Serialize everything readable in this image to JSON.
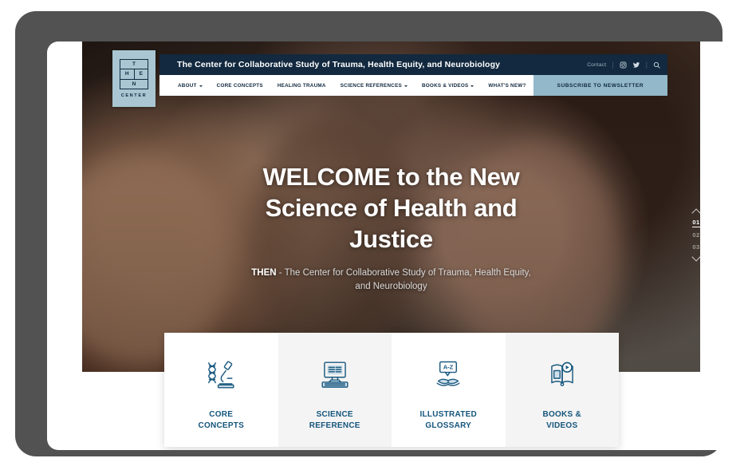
{
  "device": {
    "bezel_color": "#525252",
    "screen_bg": "#ffffff"
  },
  "brand": {
    "accent_navy": "#12293f",
    "accent_steel": "#92b8c9",
    "card_text": "#14557c",
    "logo": {
      "row1": [
        "T"
      ],
      "row2": [
        "H",
        "E"
      ],
      "row3": [
        "N"
      ],
      "word": "CENTER"
    }
  },
  "topbar": {
    "site_title": "The Center for Collaborative Study of Trauma, Health Equity, and Neurobiology",
    "contact_label": "Contact",
    "icons": [
      "instagram-icon",
      "twitter-icon",
      "search-icon"
    ]
  },
  "menubar": {
    "items": [
      {
        "label": "ABOUT",
        "has_caret": true
      },
      {
        "label": "CORE CONCEPTS",
        "has_caret": false
      },
      {
        "label": "HEALING TRAUMA",
        "has_caret": false
      },
      {
        "label": "SCIENCE REFERENCES",
        "has_caret": true
      },
      {
        "label": "BOOKS & VIDEOS",
        "has_caret": true
      },
      {
        "label": "WHAT'S NEW?",
        "has_caret": false
      }
    ],
    "subscribe_label": "SUBSCRIBE TO NEWSLETTER"
  },
  "hero": {
    "headline": "WELCOME to the New Science of Health and Justice",
    "sub_strong": "THEN",
    "sub_rest": " - The Center for Collaborative Study of Trauma, Health Equity, and Neurobiology"
  },
  "slide_nav": {
    "up_icon": "chevron-up-icon",
    "down_icon": "chevron-down-icon",
    "slides": [
      "01",
      "02",
      "03"
    ],
    "active": "01"
  },
  "cards": [
    {
      "label": "CORE\nCONCEPTS",
      "icon": "dna-microscope-icon",
      "shade": "white"
    },
    {
      "label": "SCIENCE\nREFERENCE",
      "icon": "computer-icon",
      "shade": "gray"
    },
    {
      "label": "ILLUSTRATED\nGLOSSARY",
      "icon": "az-glossary-book-icon",
      "shade": "white"
    },
    {
      "label": "BOOKS &\nVIDEOS",
      "icon": "book-play-icon",
      "shade": "gray"
    }
  ]
}
